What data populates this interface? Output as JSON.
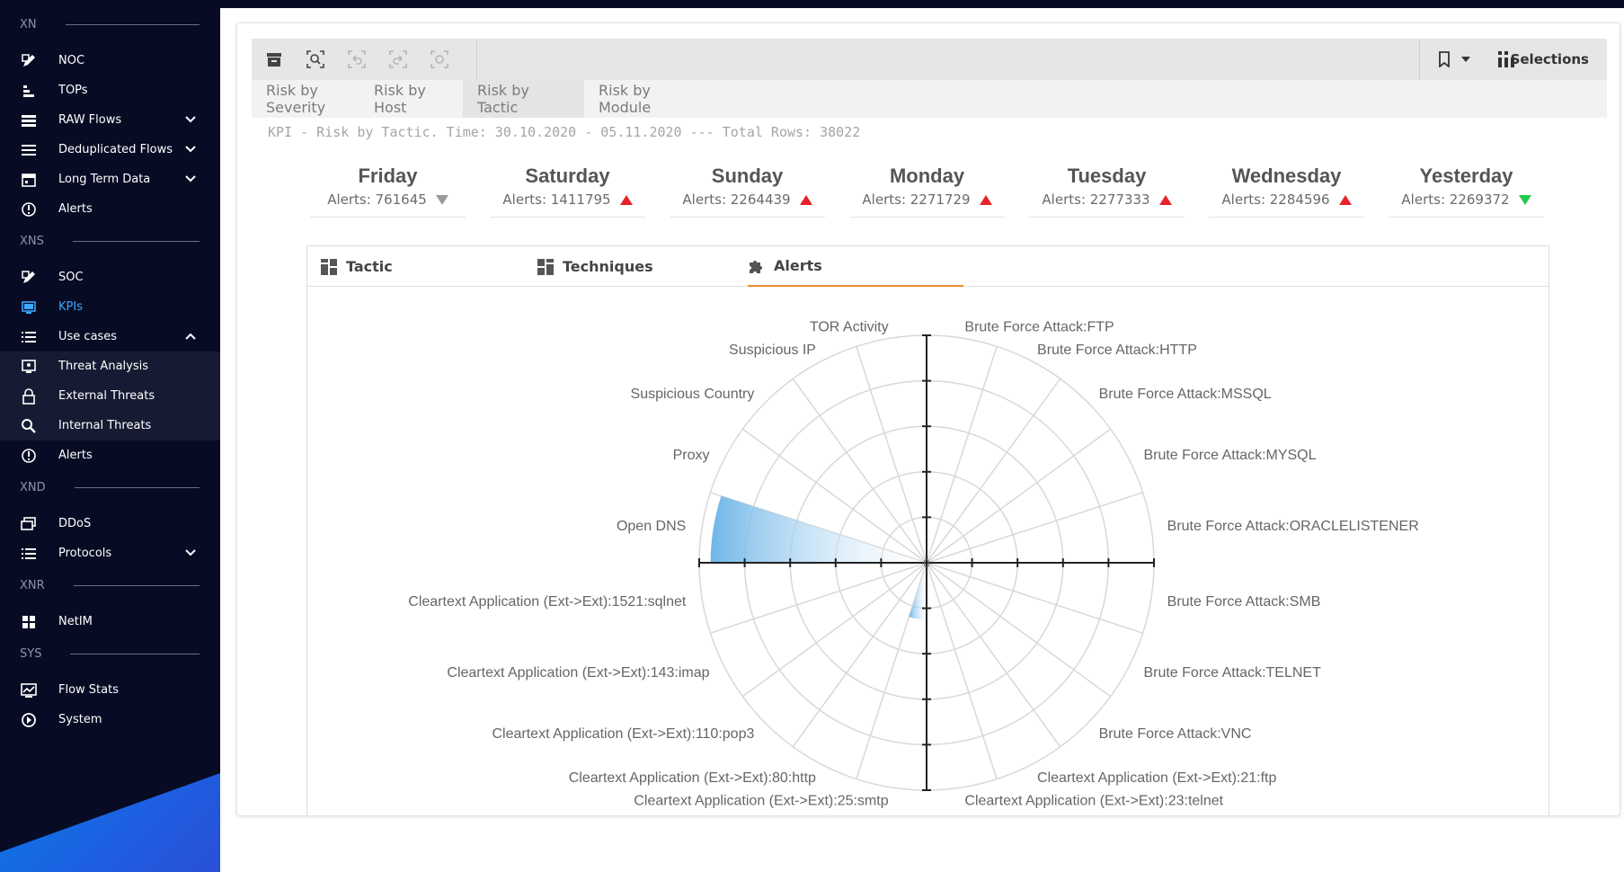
{
  "sidebar": {
    "sections": [
      {
        "label": "XN",
        "items": [
          {
            "label": "NOC",
            "icon": "noc-icon",
            "chevron": ""
          },
          {
            "label": "TOPs",
            "icon": "tops-icon",
            "chevron": ""
          },
          {
            "label": "RAW Flows",
            "icon": "raw-flows-icon",
            "chevron": "down"
          },
          {
            "label": "Deduplicated Flows",
            "icon": "dedup-flows-icon",
            "chevron": "down"
          },
          {
            "label": "Long Term Data",
            "icon": "calendar-icon",
            "chevron": "down"
          },
          {
            "label": "Alerts",
            "icon": "alert-icon",
            "chevron": ""
          }
        ]
      },
      {
        "label": "XNS",
        "items": [
          {
            "label": "SOC",
            "icon": "soc-icon",
            "chevron": ""
          },
          {
            "label": "KPIs",
            "icon": "monitor-icon",
            "chevron": "",
            "active": true
          },
          {
            "label": "Use cases",
            "icon": "list-icon",
            "chevron": "up"
          },
          {
            "label": "Threat Analysis",
            "icon": "threat-analysis-icon",
            "chevron": "",
            "sub": true
          },
          {
            "label": "External Threats",
            "icon": "lock-icon",
            "chevron": "",
            "sub": true
          },
          {
            "label": "Internal Threats",
            "icon": "search-icon",
            "chevron": "",
            "sub": true
          },
          {
            "label": "Alerts",
            "icon": "alert-icon",
            "chevron": ""
          }
        ]
      },
      {
        "label": "XND",
        "items": [
          {
            "label": "DDoS",
            "icon": "ddos-icon",
            "chevron": ""
          },
          {
            "label": "Protocols",
            "icon": "list-icon",
            "chevron": "down"
          }
        ]
      },
      {
        "label": "XNR",
        "items": [
          {
            "label": "NetIM",
            "icon": "grid-icon",
            "chevron": ""
          }
        ]
      },
      {
        "label": "SYS",
        "items": [
          {
            "label": "Flow Stats",
            "icon": "chart-icon",
            "chevron": ""
          },
          {
            "label": "System",
            "icon": "system-icon",
            "chevron": ""
          }
        ]
      }
    ]
  },
  "toolbar": {
    "selections_label": "Selections"
  },
  "tabs": [
    {
      "label": "Risk by Severity",
      "active": false
    },
    {
      "label": "Risk by Host",
      "active": false
    },
    {
      "label": "Risk by Tactic",
      "active": true
    },
    {
      "label": "Risk by Module",
      "active": false
    }
  ],
  "kpi_title": "KPI - Risk by Tactic. Time: 30.10.2020 - 05.11.2020 --- Total Rows: 38022",
  "days": [
    {
      "name": "Friday",
      "alerts": "Alerts: 761645",
      "trend": "down-grey"
    },
    {
      "name": "Saturday",
      "alerts": "Alerts: 1411795",
      "trend": "up"
    },
    {
      "name": "Sunday",
      "alerts": "Alerts: 2264439",
      "trend": "up"
    },
    {
      "name": "Monday",
      "alerts": "Alerts: 2271729",
      "trend": "up"
    },
    {
      "name": "Tuesday",
      "alerts": "Alerts: 2277333",
      "trend": "up"
    },
    {
      "name": "Wednesday",
      "alerts": "Alerts: 2284596",
      "trend": "up"
    },
    {
      "name": "Yesterday",
      "alerts": "Alerts: 2269372",
      "trend": "down-green"
    }
  ],
  "panel_tabs": [
    {
      "label": "Tactic",
      "icon": "tactic-grid-icon",
      "active": false
    },
    {
      "label": "Techniques",
      "icon": "techniques-grid-icon",
      "active": false
    },
    {
      "label": "Alerts",
      "icon": "puzzle-icon",
      "active": true
    }
  ],
  "chart_data": {
    "type": "radar",
    "center_label": "0",
    "categories": [
      "Brute Force Attack:FTP",
      "Brute Force Attack:HTTP",
      "Brute Force Attack:MSSQL",
      "Brute Force Attack:MYSQL",
      "Brute Force Attack:ORACLELISTENER",
      "Brute Force Attack:SMB",
      "Brute Force Attack:TELNET",
      "Brute Force Attack:VNC",
      "Cleartext Application (Ext->Ext):21:ftp",
      "Cleartext Application (Ext->Ext):23:telnet",
      "Cleartext Application (Ext->Ext):25:smtp",
      "Cleartext Application (Ext->Ext):80:http",
      "Cleartext Application (Ext->Ext):110:pop3",
      "Cleartext Application (Ext->Ext):143:imap",
      "Cleartext Application (Ext->Ext):1521:sqlnet",
      "Open DNS",
      "Proxy",
      "Suspicious Country",
      "Suspicious IP",
      "TOR Activity"
    ],
    "values": [
      0,
      0,
      0,
      0,
      0,
      0,
      0,
      0,
      0,
      0,
      0.25,
      0,
      0,
      0,
      0,
      0.95,
      0,
      0,
      0,
      0
    ],
    "rings": 5,
    "color": "#6fb6e8"
  }
}
